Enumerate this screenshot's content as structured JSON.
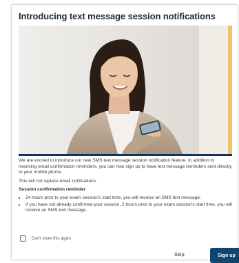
{
  "dialog": {
    "title": "Introducing text message session notifications"
  },
  "body": {
    "intro": "We are excited to introduce our new SMS text message session notification feature. In addition to receiving email confirmation reminders, you can now sign up to have text message reminders sent directly to your mobile phone.",
    "note": "This will not replace email notifications.",
    "reminder_heading": "Session confirmation reminder",
    "bullets": [
      "24 hours prior to your exam session's start time, you will receive an SMS text message.",
      "If you have not already confirmed your session, 2 hours prior to your exam session's start time, you will receive an SMS text message."
    ]
  },
  "options": {
    "dont_show_label": "Don't show this again",
    "dont_show_checked": false
  },
  "actions": {
    "skip_label": "Skip",
    "signup_label": "Sign up"
  },
  "colors": {
    "accent": "#12456e",
    "hero_underline": "#12335c",
    "hero_stripe": "#e9c46a"
  }
}
